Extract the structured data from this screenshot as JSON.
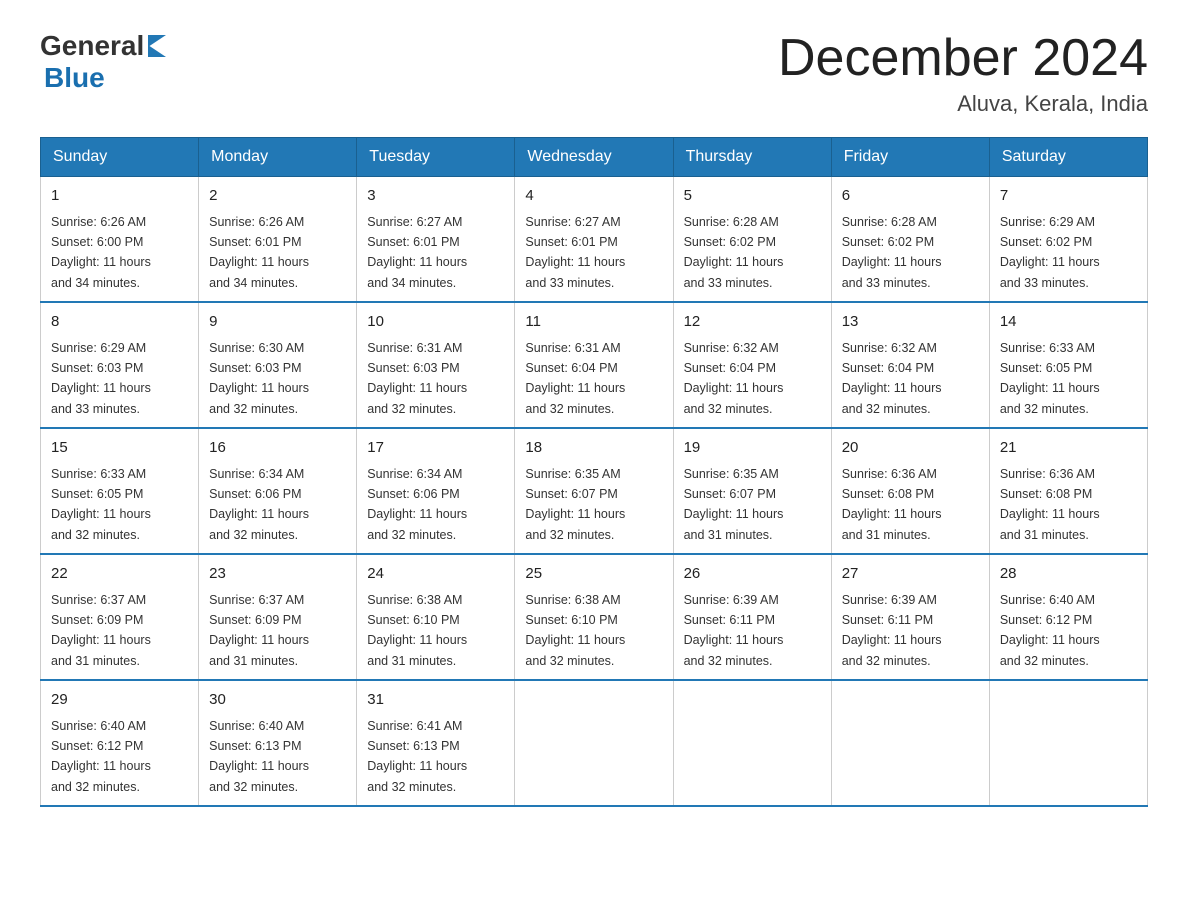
{
  "header": {
    "logo_general": "General",
    "logo_blue": "Blue",
    "month_title": "December 2024",
    "location": "Aluva, Kerala, India"
  },
  "days_of_week": [
    "Sunday",
    "Monday",
    "Tuesday",
    "Wednesday",
    "Thursday",
    "Friday",
    "Saturday"
  ],
  "weeks": [
    [
      {
        "day": "1",
        "sunrise": "6:26 AM",
        "sunset": "6:00 PM",
        "daylight": "11 hours and 34 minutes."
      },
      {
        "day": "2",
        "sunrise": "6:26 AM",
        "sunset": "6:01 PM",
        "daylight": "11 hours and 34 minutes."
      },
      {
        "day": "3",
        "sunrise": "6:27 AM",
        "sunset": "6:01 PM",
        "daylight": "11 hours and 34 minutes."
      },
      {
        "day": "4",
        "sunrise": "6:27 AM",
        "sunset": "6:01 PM",
        "daylight": "11 hours and 33 minutes."
      },
      {
        "day": "5",
        "sunrise": "6:28 AM",
        "sunset": "6:02 PM",
        "daylight": "11 hours and 33 minutes."
      },
      {
        "day": "6",
        "sunrise": "6:28 AM",
        "sunset": "6:02 PM",
        "daylight": "11 hours and 33 minutes."
      },
      {
        "day": "7",
        "sunrise": "6:29 AM",
        "sunset": "6:02 PM",
        "daylight": "11 hours and 33 minutes."
      }
    ],
    [
      {
        "day": "8",
        "sunrise": "6:29 AM",
        "sunset": "6:03 PM",
        "daylight": "11 hours and 33 minutes."
      },
      {
        "day": "9",
        "sunrise": "6:30 AM",
        "sunset": "6:03 PM",
        "daylight": "11 hours and 32 minutes."
      },
      {
        "day": "10",
        "sunrise": "6:31 AM",
        "sunset": "6:03 PM",
        "daylight": "11 hours and 32 minutes."
      },
      {
        "day": "11",
        "sunrise": "6:31 AM",
        "sunset": "6:04 PM",
        "daylight": "11 hours and 32 minutes."
      },
      {
        "day": "12",
        "sunrise": "6:32 AM",
        "sunset": "6:04 PM",
        "daylight": "11 hours and 32 minutes."
      },
      {
        "day": "13",
        "sunrise": "6:32 AM",
        "sunset": "6:04 PM",
        "daylight": "11 hours and 32 minutes."
      },
      {
        "day": "14",
        "sunrise": "6:33 AM",
        "sunset": "6:05 PM",
        "daylight": "11 hours and 32 minutes."
      }
    ],
    [
      {
        "day": "15",
        "sunrise": "6:33 AM",
        "sunset": "6:05 PM",
        "daylight": "11 hours and 32 minutes."
      },
      {
        "day": "16",
        "sunrise": "6:34 AM",
        "sunset": "6:06 PM",
        "daylight": "11 hours and 32 minutes."
      },
      {
        "day": "17",
        "sunrise": "6:34 AM",
        "sunset": "6:06 PM",
        "daylight": "11 hours and 32 minutes."
      },
      {
        "day": "18",
        "sunrise": "6:35 AM",
        "sunset": "6:07 PM",
        "daylight": "11 hours and 32 minutes."
      },
      {
        "day": "19",
        "sunrise": "6:35 AM",
        "sunset": "6:07 PM",
        "daylight": "11 hours and 31 minutes."
      },
      {
        "day": "20",
        "sunrise": "6:36 AM",
        "sunset": "6:08 PM",
        "daylight": "11 hours and 31 minutes."
      },
      {
        "day": "21",
        "sunrise": "6:36 AM",
        "sunset": "6:08 PM",
        "daylight": "11 hours and 31 minutes."
      }
    ],
    [
      {
        "day": "22",
        "sunrise": "6:37 AM",
        "sunset": "6:09 PM",
        "daylight": "11 hours and 31 minutes."
      },
      {
        "day": "23",
        "sunrise": "6:37 AM",
        "sunset": "6:09 PM",
        "daylight": "11 hours and 31 minutes."
      },
      {
        "day": "24",
        "sunrise": "6:38 AM",
        "sunset": "6:10 PM",
        "daylight": "11 hours and 31 minutes."
      },
      {
        "day": "25",
        "sunrise": "6:38 AM",
        "sunset": "6:10 PM",
        "daylight": "11 hours and 32 minutes."
      },
      {
        "day": "26",
        "sunrise": "6:39 AM",
        "sunset": "6:11 PM",
        "daylight": "11 hours and 32 minutes."
      },
      {
        "day": "27",
        "sunrise": "6:39 AM",
        "sunset": "6:11 PM",
        "daylight": "11 hours and 32 minutes."
      },
      {
        "day": "28",
        "sunrise": "6:40 AM",
        "sunset": "6:12 PM",
        "daylight": "11 hours and 32 minutes."
      }
    ],
    [
      {
        "day": "29",
        "sunrise": "6:40 AM",
        "sunset": "6:12 PM",
        "daylight": "11 hours and 32 minutes."
      },
      {
        "day": "30",
        "sunrise": "6:40 AM",
        "sunset": "6:13 PM",
        "daylight": "11 hours and 32 minutes."
      },
      {
        "day": "31",
        "sunrise": "6:41 AM",
        "sunset": "6:13 PM",
        "daylight": "11 hours and 32 minutes."
      },
      null,
      null,
      null,
      null
    ]
  ],
  "labels": {
    "sunrise": "Sunrise:",
    "sunset": "Sunset:",
    "daylight": "Daylight:"
  }
}
